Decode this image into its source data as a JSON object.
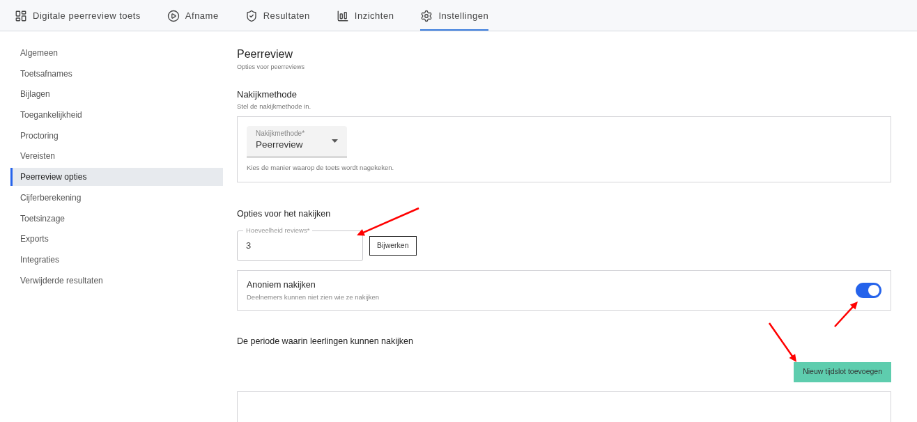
{
  "tabs": [
    {
      "label": "Digitale peerreview toets",
      "selected": false
    },
    {
      "label": "Afname",
      "selected": false
    },
    {
      "label": "Resultaten",
      "selected": false
    },
    {
      "label": "Inzichten",
      "selected": false
    },
    {
      "label": "Instellingen",
      "selected": true
    }
  ],
  "sidebar": {
    "items": [
      {
        "label": "Algemeen",
        "selected": false
      },
      {
        "label": "Toetsafnames",
        "selected": false
      },
      {
        "label": "Bijlagen",
        "selected": false
      },
      {
        "label": "Toegankelijkheid",
        "selected": false
      },
      {
        "label": "Proctoring",
        "selected": false
      },
      {
        "label": "Vereisten",
        "selected": false
      },
      {
        "label": "Peerreview opties",
        "selected": true
      },
      {
        "label": "Cijferberekening",
        "selected": false
      },
      {
        "label": "Toetsinzage",
        "selected": false
      },
      {
        "label": "Exports",
        "selected": false
      },
      {
        "label": "Integraties",
        "selected": false
      },
      {
        "label": "Verwijderde resultaten",
        "selected": false
      }
    ]
  },
  "page": {
    "title": "Peerreview",
    "subtitle": "Opties voor peerreviews"
  },
  "method": {
    "title": "Nakijkmethode",
    "subtitle": "Stel de nakijkmethode in.",
    "select": {
      "label": "Nakijkmethode*",
      "value": "Peerreview"
    },
    "hint": "Kies de manier waarop de toets wordt nagekeken."
  },
  "options": {
    "title": "Opties voor het nakijken",
    "reviews": {
      "label": "Hoeveelheid reviews*",
      "value": "3"
    },
    "update_button": "Bijwerken"
  },
  "anonymous": {
    "title": "Anoniem nakijken",
    "description": "Deelnemers kunnen niet zien wie ze nakijken",
    "on": true
  },
  "period": {
    "title": "De periode waarin leerlingen kunnen nakijken",
    "add_button": "Nieuw tijdslot toevoegen"
  }
}
